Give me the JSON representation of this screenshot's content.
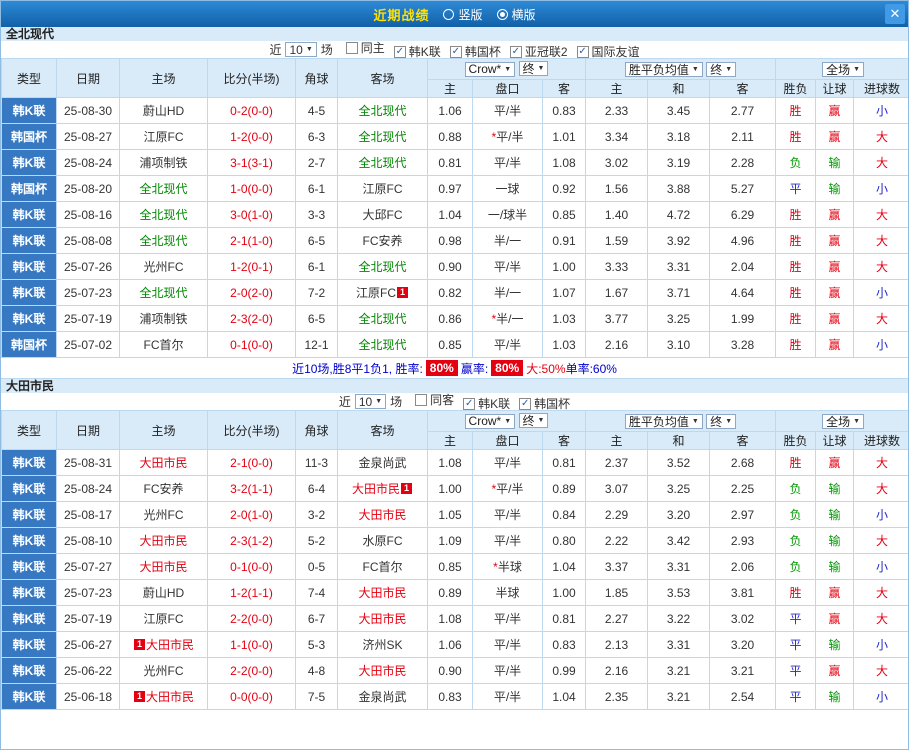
{
  "titlebar": {
    "title": "近期战绩",
    "radio_vertical": "竖版",
    "radio_horizontal": "横版",
    "close": "✕"
  },
  "controls": {
    "near": "近",
    "count": "10",
    "games": "场",
    "odds_source": "Crow*",
    "final": "终",
    "avg_label": "胜平负均值",
    "fullmatch": "全场"
  },
  "columns": {
    "type": "类型",
    "date": "日期",
    "home": "主场",
    "score": "比分(半场)",
    "corner": "角球",
    "away": "客场",
    "odds_sub": [
      "主",
      "盘口",
      "客"
    ],
    "avg_sub": [
      "主",
      "和",
      "客"
    ],
    "result_sub": [
      "胜负",
      "让球",
      "进球数"
    ]
  },
  "result_colors": {
    "r": "#E50011",
    "b": "#2424CC",
    "g": "#009900"
  },
  "sections": [
    {
      "team": "全北现代",
      "team_color": "#008800",
      "filters": [
        {
          "label": "同主",
          "checked": false
        },
        {
          "label": "韩K联",
          "checked": true
        },
        {
          "label": "韩国杯",
          "checked": true
        },
        {
          "label": "亚冠联2",
          "checked": true
        },
        {
          "label": "国际友谊",
          "checked": true
        }
      ],
      "rows": [
        {
          "league": "韩K联",
          "date": "25-08-30",
          "home": "蔚山HD",
          "home_hl": false,
          "score": "0-2(0-0)",
          "corner": "4-5",
          "away": "全北现代",
          "away_hl": true,
          "odds": [
            "1.06",
            "平/半",
            "0.83"
          ],
          "avg": [
            "2.33",
            "3.45",
            "2.77"
          ],
          "results": [
            [
              "胜",
              "r"
            ],
            [
              "赢",
              "r"
            ],
            [
              "小",
              "b"
            ]
          ]
        },
        {
          "league": "韩国杯",
          "date": "25-08-27",
          "home": "江原FC",
          "home_hl": false,
          "score": "1-2(0-0)",
          "corner": "6-3",
          "away": "全北现代",
          "away_hl": true,
          "odds": [
            "0.88",
            "*平/半",
            "1.01"
          ],
          "avg": [
            "3.34",
            "3.18",
            "2.11"
          ],
          "results": [
            [
              "胜",
              "r"
            ],
            [
              "赢",
              "r"
            ],
            [
              "大",
              "r"
            ]
          ]
        },
        {
          "league": "韩K联",
          "date": "25-08-24",
          "home": "浦项制铁",
          "home_hl": false,
          "score": "3-1(3-1)",
          "corner": "2-7",
          "away": "全北现代",
          "away_hl": true,
          "odds": [
            "0.81",
            "平/半",
            "1.08"
          ],
          "avg": [
            "3.02",
            "3.19",
            "2.28"
          ],
          "results": [
            [
              "负",
              "g"
            ],
            [
              "输",
              "g"
            ],
            [
              "大",
              "r"
            ]
          ]
        },
        {
          "league": "韩国杯",
          "date": "25-08-20",
          "home": "全北现代",
          "home_hl": true,
          "score": "1-0(0-0)",
          "corner": "6-1",
          "away": "江原FC",
          "away_hl": false,
          "odds": [
            "0.97",
            "一球",
            "0.92"
          ],
          "avg": [
            "1.56",
            "3.88",
            "5.27"
          ],
          "results": [
            [
              "平",
              "b"
            ],
            [
              "输",
              "g"
            ],
            [
              "小",
              "b"
            ]
          ]
        },
        {
          "league": "韩K联",
          "date": "25-08-16",
          "home": "全北现代",
          "home_hl": true,
          "score": "3-0(1-0)",
          "corner": "3-3",
          "away": "大邱FC",
          "away_hl": false,
          "odds": [
            "1.04",
            "一/球半",
            "0.85"
          ],
          "avg": [
            "1.40",
            "4.72",
            "6.29"
          ],
          "results": [
            [
              "胜",
              "r"
            ],
            [
              "赢",
              "r"
            ],
            [
              "大",
              "r"
            ]
          ]
        },
        {
          "league": "韩K联",
          "date": "25-08-08",
          "home": "全北现代",
          "home_hl": true,
          "score": "2-1(1-0)",
          "corner": "6-5",
          "away": "FC安养",
          "away_hl": false,
          "odds": [
            "0.98",
            "半/一",
            "0.91"
          ],
          "avg": [
            "1.59",
            "3.92",
            "4.96"
          ],
          "results": [
            [
              "胜",
              "r"
            ],
            [
              "赢",
              "r"
            ],
            [
              "大",
              "r"
            ]
          ]
        },
        {
          "league": "韩K联",
          "date": "25-07-26",
          "home": "光州FC",
          "home_hl": false,
          "score": "1-2(0-1)",
          "corner": "6-1",
          "away": "全北现代",
          "away_hl": true,
          "odds": [
            "0.90",
            "平/半",
            "1.00"
          ],
          "avg": [
            "3.33",
            "3.31",
            "2.04"
          ],
          "results": [
            [
              "胜",
              "r"
            ],
            [
              "赢",
              "r"
            ],
            [
              "大",
              "r"
            ]
          ]
        },
        {
          "league": "韩K联",
          "date": "25-07-23",
          "home": "全北现代",
          "home_hl": true,
          "score": "2-0(2-0)",
          "corner": "7-2",
          "away": "江原FC",
          "away_hl": false,
          "away_badge": "1",
          "odds": [
            "0.82",
            "半/一",
            "1.07"
          ],
          "avg": [
            "1.67",
            "3.71",
            "4.64"
          ],
          "results": [
            [
              "胜",
              "r"
            ],
            [
              "赢",
              "r"
            ],
            [
              "小",
              "b"
            ]
          ]
        },
        {
          "league": "韩K联",
          "date": "25-07-19",
          "home": "浦项制铁",
          "home_hl": false,
          "score": "2-3(2-0)",
          "corner": "6-5",
          "away": "全北现代",
          "away_hl": true,
          "odds": [
            "0.86",
            "*半/一",
            "1.03"
          ],
          "avg": [
            "3.77",
            "3.25",
            "1.99"
          ],
          "results": [
            [
              "胜",
              "r"
            ],
            [
              "赢",
              "r"
            ],
            [
              "大",
              "r"
            ]
          ]
        },
        {
          "league": "韩国杯",
          "date": "25-07-02",
          "home": "FC首尔",
          "home_hl": false,
          "score": "0-1(0-0)",
          "corner": "12-1",
          "away": "全北现代",
          "away_hl": true,
          "odds": [
            "0.85",
            "平/半",
            "1.03"
          ],
          "avg": [
            "2.16",
            "3.10",
            "3.28"
          ],
          "results": [
            [
              "胜",
              "r"
            ],
            [
              "赢",
              "r"
            ],
            [
              "小",
              "b"
            ]
          ]
        }
      ],
      "summary": {
        "prefix": "近10场,胜8平1负1, 胜率: ",
        "win_rate": "80%",
        "odds_label": " 赢率:",
        "odds_rate": "80%",
        "big_text": " 大:50%",
        "single_text": " 单率:60%"
      }
    },
    {
      "team": "大田市民",
      "team_color": "#E50011",
      "filters": [
        {
          "label": "同客",
          "checked": false
        },
        {
          "label": "韩K联",
          "checked": true
        },
        {
          "label": "韩国杯",
          "checked": true
        }
      ],
      "rows": [
        {
          "league": "韩K联",
          "date": "25-08-31",
          "home": "大田市民",
          "home_hl": true,
          "score": "2-1(0-0)",
          "corner": "11-3",
          "away": "金泉尚武",
          "away_hl": false,
          "odds": [
            "1.08",
            "平/半",
            "0.81"
          ],
          "avg": [
            "2.37",
            "3.52",
            "2.68"
          ],
          "results": [
            [
              "胜",
              "r"
            ],
            [
              "赢",
              "r"
            ],
            [
              "大",
              "r"
            ]
          ]
        },
        {
          "league": "韩K联",
          "date": "25-08-24",
          "home": "FC安养",
          "home_hl": false,
          "score": "3-2(1-1)",
          "corner": "6-4",
          "away": "大田市民",
          "away_hl": true,
          "away_badge": "1",
          "odds": [
            "1.00",
            "*平/半",
            "0.89"
          ],
          "avg": [
            "3.07",
            "3.25",
            "2.25"
          ],
          "results": [
            [
              "负",
              "g"
            ],
            [
              "输",
              "g"
            ],
            [
              "大",
              "r"
            ]
          ]
        },
        {
          "league": "韩K联",
          "date": "25-08-17",
          "home": "光州FC",
          "home_hl": false,
          "score": "2-0(1-0)",
          "corner": "3-2",
          "away": "大田市民",
          "away_hl": true,
          "odds": [
            "1.05",
            "平/半",
            "0.84"
          ],
          "avg": [
            "2.29",
            "3.20",
            "2.97"
          ],
          "results": [
            [
              "负",
              "g"
            ],
            [
              "输",
              "g"
            ],
            [
              "小",
              "b"
            ]
          ]
        },
        {
          "league": "韩K联",
          "date": "25-08-10",
          "home": "大田市民",
          "home_hl": true,
          "score": "2-3(1-2)",
          "corner": "5-2",
          "away": "水原FC",
          "away_hl": false,
          "odds": [
            "1.09",
            "平/半",
            "0.80"
          ],
          "avg": [
            "2.22",
            "3.42",
            "2.93"
          ],
          "results": [
            [
              "负",
              "g"
            ],
            [
              "输",
              "g"
            ],
            [
              "大",
              "r"
            ]
          ]
        },
        {
          "league": "韩K联",
          "date": "25-07-27",
          "home": "大田市民",
          "home_hl": true,
          "score": "0-1(0-0)",
          "corner": "0-5",
          "away": "FC首尔",
          "away_hl": false,
          "odds": [
            "0.85",
            "*半球",
            "1.04"
          ],
          "avg": [
            "3.37",
            "3.31",
            "2.06"
          ],
          "results": [
            [
              "负",
              "g"
            ],
            [
              "输",
              "g"
            ],
            [
              "小",
              "b"
            ]
          ]
        },
        {
          "league": "韩K联",
          "date": "25-07-23",
          "home": "蔚山HD",
          "home_hl": false,
          "score": "1-2(1-1)",
          "corner": "7-4",
          "away": "大田市民",
          "away_hl": true,
          "odds": [
            "0.89",
            "半球",
            "1.00"
          ],
          "avg": [
            "1.85",
            "3.53",
            "3.81"
          ],
          "results": [
            [
              "胜",
              "r"
            ],
            [
              "赢",
              "r"
            ],
            [
              "大",
              "r"
            ]
          ]
        },
        {
          "league": "韩K联",
          "date": "25-07-19",
          "home": "江原FC",
          "home_hl": false,
          "score": "2-2(0-0)",
          "corner": "6-7",
          "away": "大田市民",
          "away_hl": true,
          "odds": [
            "1.08",
            "平/半",
            "0.81"
          ],
          "avg": [
            "2.27",
            "3.22",
            "3.02"
          ],
          "results": [
            [
              "平",
              "b"
            ],
            [
              "赢",
              "r"
            ],
            [
              "大",
              "r"
            ]
          ]
        },
        {
          "league": "韩K联",
          "date": "25-06-27",
          "home": "大田市民",
          "home_hl": true,
          "home_badge": "1",
          "score": "1-1(0-0)",
          "corner": "5-3",
          "away": "济州SK",
          "away_hl": false,
          "odds": [
            "1.06",
            "平/半",
            "0.83"
          ],
          "avg": [
            "2.13",
            "3.31",
            "3.20"
          ],
          "results": [
            [
              "平",
              "b"
            ],
            [
              "输",
              "g"
            ],
            [
              "小",
              "b"
            ]
          ]
        },
        {
          "league": "韩K联",
          "date": "25-06-22",
          "home": "光州FC",
          "home_hl": false,
          "score": "2-2(0-0)",
          "corner": "4-8",
          "away": "大田市民",
          "away_hl": true,
          "odds": [
            "0.90",
            "平/半",
            "0.99"
          ],
          "avg": [
            "2.16",
            "3.21",
            "3.21"
          ],
          "results": [
            [
              "平",
              "b"
            ],
            [
              "赢",
              "r"
            ],
            [
              "大",
              "r"
            ]
          ]
        },
        {
          "league": "韩K联",
          "date": "25-06-18",
          "home": "大田市民",
          "home_hl": true,
          "home_badge": "1",
          "score": "0-0(0-0)",
          "corner": "7-5",
          "away": "金泉尚武",
          "away_hl": false,
          "odds": [
            "0.83",
            "平/半",
            "1.04"
          ],
          "avg": [
            "2.35",
            "3.21",
            "2.54"
          ],
          "results": [
            [
              "平",
              "b"
            ],
            [
              "输",
              "g"
            ],
            [
              "小",
              "b"
            ]
          ]
        }
      ]
    }
  ]
}
